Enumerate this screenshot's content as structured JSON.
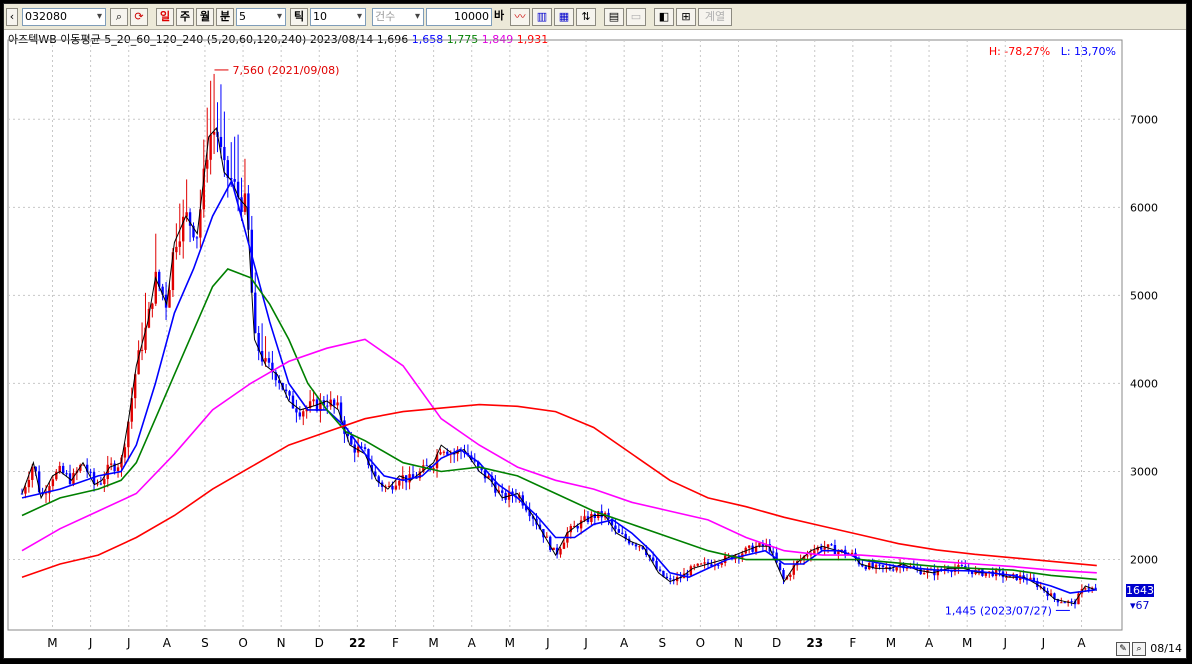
{
  "toolbar": {
    "code": "032080",
    "periods": [
      "일",
      "주",
      "월",
      "분"
    ],
    "minute_value": "5",
    "tick_label": "틱",
    "tick_value": "10",
    "count_label": "건수",
    "count_value": "10000",
    "count_unit": "바",
    "disabled_button": "계열"
  },
  "header": {
    "name": "아즈텍WB 이동평균 5_20_60_120_240",
    "params": "(5,20,60,120,240)",
    "date": "2023/08/14",
    "ma_values": [
      "1,696",
      "1,658",
      "1,775",
      "1,849",
      "1,931"
    ],
    "high_label": "H: -78,27%",
    "low_label": "L: 13,70%"
  },
  "footer_date": "08/14",
  "colors": {
    "ma5": "#000000",
    "ma20": "#0000ff",
    "ma60": "#008000",
    "ma120": "#ff00ff",
    "ma240": "#ff0000",
    "up": "#e00000",
    "down": "#0000ff",
    "grid": "#c8c8c8"
  },
  "chart_data": {
    "type": "line",
    "y_ticks": [
      2000,
      3000,
      4000,
      5000,
      6000,
      7000
    ],
    "ylim": [
      1200,
      7900
    ],
    "x_ticks": [
      "M",
      "J",
      "J",
      "A",
      "S",
      "O",
      "N",
      "D",
      "22",
      "F",
      "M",
      "A",
      "M",
      "J",
      "J",
      "A",
      "S",
      "O",
      "N",
      "D",
      "23",
      "F",
      "M",
      "A",
      "M",
      "J",
      "J",
      "A"
    ],
    "annotations": [
      {
        "label": "7,560 (2021/09/08)",
        "t": 5.05,
        "value": 7560
      },
      {
        "label": "1,445 (2023/07/27)",
        "t": 27.6,
        "value": 1445
      }
    ],
    "current_price": "1643",
    "change": "67",
    "price_series": [
      {
        "t": 0.0,
        "v": 2750
      },
      {
        "t": 0.3,
        "v": 3100
      },
      {
        "t": 0.5,
        "v": 2700
      },
      {
        "t": 0.8,
        "v": 2950
      },
      {
        "t": 1.0,
        "v": 3000
      },
      {
        "t": 1.3,
        "v": 2900
      },
      {
        "t": 1.6,
        "v": 3100
      },
      {
        "t": 1.9,
        "v": 2850
      },
      {
        "t": 2.1,
        "v": 2900
      },
      {
        "t": 2.3,
        "v": 3050
      },
      {
        "t": 2.6,
        "v": 3100
      },
      {
        "t": 2.8,
        "v": 3600
      },
      {
        "t": 3.0,
        "v": 4200
      },
      {
        "t": 3.3,
        "v": 4700
      },
      {
        "t": 3.5,
        "v": 5200
      },
      {
        "t": 3.8,
        "v": 4900
      },
      {
        "t": 4.0,
        "v": 5600
      },
      {
        "t": 4.3,
        "v": 5900
      },
      {
        "t": 4.6,
        "v": 5700
      },
      {
        "t": 4.9,
        "v": 6800
      },
      {
        "t": 5.1,
        "v": 6900
      },
      {
        "t": 5.3,
        "v": 6400
      },
      {
        "t": 5.5,
        "v": 6300
      },
      {
        "t": 5.7,
        "v": 6100
      },
      {
        "t": 5.9,
        "v": 6000
      },
      {
        "t": 6.1,
        "v": 4500
      },
      {
        "t": 6.4,
        "v": 4200
      },
      {
        "t": 6.7,
        "v": 4100
      },
      {
        "t": 7.0,
        "v": 3800
      },
      {
        "t": 7.3,
        "v": 3700
      },
      {
        "t": 7.7,
        "v": 3750
      },
      {
        "t": 8.0,
        "v": 3800
      },
      {
        "t": 8.3,
        "v": 3700
      },
      {
        "t": 8.6,
        "v": 3300
      },
      {
        "t": 9.0,
        "v": 3200
      },
      {
        "t": 9.3,
        "v": 2900
      },
      {
        "t": 9.6,
        "v": 2800
      },
      {
        "t": 9.9,
        "v": 2950
      },
      {
        "t": 10.2,
        "v": 2900
      },
      {
        "t": 10.5,
        "v": 3000
      },
      {
        "t": 10.8,
        "v": 3100
      },
      {
        "t": 11.0,
        "v": 3300
      },
      {
        "t": 11.3,
        "v": 3200
      },
      {
        "t": 11.6,
        "v": 3250
      },
      {
        "t": 12.0,
        "v": 3000
      },
      {
        "t": 12.3,
        "v": 2900
      },
      {
        "t": 12.6,
        "v": 2700
      },
      {
        "t": 13.0,
        "v": 2750
      },
      {
        "t": 13.4,
        "v": 2500
      },
      {
        "t": 13.8,
        "v": 2200
      },
      {
        "t": 14.0,
        "v": 2050
      },
      {
        "t": 14.3,
        "v": 2300
      },
      {
        "t": 14.6,
        "v": 2400
      },
      {
        "t": 15.0,
        "v": 2500
      },
      {
        "t": 15.3,
        "v": 2500
      },
      {
        "t": 15.6,
        "v": 2300
      },
      {
        "t": 16.0,
        "v": 2200
      },
      {
        "t": 16.3,
        "v": 2150
      },
      {
        "t": 16.7,
        "v": 1850
      },
      {
        "t": 17.0,
        "v": 1750
      },
      {
        "t": 17.3,
        "v": 1800
      },
      {
        "t": 17.6,
        "v": 1900
      },
      {
        "t": 18.0,
        "v": 1950
      },
      {
        "t": 18.4,
        "v": 2000
      },
      {
        "t": 18.7,
        "v": 2050
      },
      {
        "t": 19.0,
        "v": 2100
      },
      {
        "t": 19.3,
        "v": 2150
      },
      {
        "t": 19.6,
        "v": 2150
      },
      {
        "t": 20.0,
        "v": 1750
      },
      {
        "t": 20.3,
        "v": 1950
      },
      {
        "t": 20.7,
        "v": 2100
      },
      {
        "t": 21.0,
        "v": 2150
      },
      {
        "t": 21.4,
        "v": 2100
      },
      {
        "t": 21.8,
        "v": 2050
      },
      {
        "t": 22.0,
        "v": 1950
      },
      {
        "t": 22.4,
        "v": 1900
      },
      {
        "t": 22.8,
        "v": 1900
      },
      {
        "t": 23.1,
        "v": 1950
      },
      {
        "t": 23.5,
        "v": 1880
      },
      {
        "t": 23.9,
        "v": 1850
      },
      {
        "t": 24.3,
        "v": 1900
      },
      {
        "t": 24.7,
        "v": 1900
      },
      {
        "t": 25.1,
        "v": 1850
      },
      {
        "t": 25.5,
        "v": 1850
      },
      {
        "t": 25.9,
        "v": 1800
      },
      {
        "t": 26.3,
        "v": 1800
      },
      {
        "t": 26.7,
        "v": 1700
      },
      {
        "t": 27.1,
        "v": 1550
      },
      {
        "t": 27.6,
        "v": 1500
      },
      {
        "t": 27.9,
        "v": 1700
      },
      {
        "t": 28.2,
        "v": 1650
      }
    ],
    "series": [
      {
        "key": "ma20",
        "points": [
          {
            "t": 0.0,
            "v": 2700
          },
          {
            "t": 1.0,
            "v": 2800
          },
          {
            "t": 2.0,
            "v": 2950
          },
          {
            "t": 2.6,
            "v": 3000
          },
          {
            "t": 3.0,
            "v": 3300
          },
          {
            "t": 3.5,
            "v": 4000
          },
          {
            "t": 4.0,
            "v": 4800
          },
          {
            "t": 4.5,
            "v": 5300
          },
          {
            "t": 5.0,
            "v": 5900
          },
          {
            "t": 5.5,
            "v": 6300
          },
          {
            "t": 6.0,
            "v": 5500
          },
          {
            "t": 6.5,
            "v": 4700
          },
          {
            "t": 7.0,
            "v": 4000
          },
          {
            "t": 7.5,
            "v": 3700
          },
          {
            "t": 8.0,
            "v": 3700
          },
          {
            "t": 8.5,
            "v": 3500
          },
          {
            "t": 9.0,
            "v": 3200
          },
          {
            "t": 9.5,
            "v": 2950
          },
          {
            "t": 10.0,
            "v": 2900
          },
          {
            "t": 10.5,
            "v": 2950
          },
          {
            "t": 11.0,
            "v": 3150
          },
          {
            "t": 11.5,
            "v": 3250
          },
          {
            "t": 12.0,
            "v": 3100
          },
          {
            "t": 12.5,
            "v": 2850
          },
          {
            "t": 13.0,
            "v": 2700
          },
          {
            "t": 13.5,
            "v": 2500
          },
          {
            "t": 14.0,
            "v": 2250
          },
          {
            "t": 14.5,
            "v": 2250
          },
          {
            "t": 15.0,
            "v": 2400
          },
          {
            "t": 15.5,
            "v": 2450
          },
          {
            "t": 16.0,
            "v": 2300
          },
          {
            "t": 16.5,
            "v": 2100
          },
          {
            "t": 17.0,
            "v": 1850
          },
          {
            "t": 17.5,
            "v": 1800
          },
          {
            "t": 18.0,
            "v": 1900
          },
          {
            "t": 18.5,
            "v": 2000
          },
          {
            "t": 19.0,
            "v": 2050
          },
          {
            "t": 19.5,
            "v": 2100
          },
          {
            "t": 20.0,
            "v": 1950
          },
          {
            "t": 20.5,
            "v": 1950
          },
          {
            "t": 21.0,
            "v": 2100
          },
          {
            "t": 21.5,
            "v": 2100
          },
          {
            "t": 22.0,
            "v": 2000
          },
          {
            "t": 23.0,
            "v": 1920
          },
          {
            "t": 24.0,
            "v": 1880
          },
          {
            "t": 25.0,
            "v": 1870
          },
          {
            "t": 26.0,
            "v": 1820
          },
          {
            "t": 27.0,
            "v": 1700
          },
          {
            "t": 27.5,
            "v": 1620
          },
          {
            "t": 28.2,
            "v": 1658
          }
        ]
      },
      {
        "key": "ma60",
        "points": [
          {
            "t": 0.0,
            "v": 2500
          },
          {
            "t": 1.0,
            "v": 2700
          },
          {
            "t": 2.0,
            "v": 2800
          },
          {
            "t": 2.6,
            "v": 2900
          },
          {
            "t": 3.0,
            "v": 3100
          },
          {
            "t": 3.5,
            "v": 3600
          },
          {
            "t": 4.0,
            "v": 4100
          },
          {
            "t": 4.5,
            "v": 4600
          },
          {
            "t": 5.0,
            "v": 5100
          },
          {
            "t": 5.4,
            "v": 5300
          },
          {
            "t": 6.0,
            "v": 5200
          },
          {
            "t": 6.5,
            "v": 4900
          },
          {
            "t": 7.0,
            "v": 4500
          },
          {
            "t": 7.5,
            "v": 4000
          },
          {
            "t": 8.0,
            "v": 3700
          },
          {
            "t": 8.5,
            "v": 3450
          },
          {
            "t": 9.0,
            "v": 3350
          },
          {
            "t": 10.0,
            "v": 3100
          },
          {
            "t": 11.0,
            "v": 3000
          },
          {
            "t": 12.0,
            "v": 3050
          },
          {
            "t": 13.0,
            "v": 2950
          },
          {
            "t": 14.0,
            "v": 2750
          },
          {
            "t": 15.0,
            "v": 2550
          },
          {
            "t": 16.0,
            "v": 2400
          },
          {
            "t": 17.0,
            "v": 2250
          },
          {
            "t": 18.0,
            "v": 2100
          },
          {
            "t": 19.0,
            "v": 2000
          },
          {
            "t": 20.0,
            "v": 2000
          },
          {
            "t": 21.0,
            "v": 2000
          },
          {
            "t": 22.0,
            "v": 2000
          },
          {
            "t": 23.0,
            "v": 1960
          },
          {
            "t": 24.0,
            "v": 1920
          },
          {
            "t": 25.0,
            "v": 1900
          },
          {
            "t": 26.0,
            "v": 1880
          },
          {
            "t": 27.0,
            "v": 1820
          },
          {
            "t": 28.2,
            "v": 1775
          }
        ]
      },
      {
        "key": "ma120",
        "points": [
          {
            "t": 0.0,
            "v": 2100
          },
          {
            "t": 1.0,
            "v": 2350
          },
          {
            "t": 2.0,
            "v": 2550
          },
          {
            "t": 3.0,
            "v": 2750
          },
          {
            "t": 4.0,
            "v": 3200
          },
          {
            "t": 5.0,
            "v": 3700
          },
          {
            "t": 6.0,
            "v": 4000
          },
          {
            "t": 7.0,
            "v": 4250
          },
          {
            "t": 8.0,
            "v": 4400
          },
          {
            "t": 9.0,
            "v": 4500
          },
          {
            "t": 10.0,
            "v": 4200
          },
          {
            "t": 11.0,
            "v": 3600
          },
          {
            "t": 12.0,
            "v": 3300
          },
          {
            "t": 13.0,
            "v": 3050
          },
          {
            "t": 14.0,
            "v": 2900
          },
          {
            "t": 15.0,
            "v": 2800
          },
          {
            "t": 16.0,
            "v": 2650
          },
          {
            "t": 17.0,
            "v": 2550
          },
          {
            "t": 18.0,
            "v": 2450
          },
          {
            "t": 19.0,
            "v": 2250
          },
          {
            "t": 20.0,
            "v": 2100
          },
          {
            "t": 21.0,
            "v": 2050
          },
          {
            "t": 22.0,
            "v": 2050
          },
          {
            "t": 23.0,
            "v": 2020
          },
          {
            "t": 24.0,
            "v": 1980
          },
          {
            "t": 25.0,
            "v": 1950
          },
          {
            "t": 26.0,
            "v": 1920
          },
          {
            "t": 27.0,
            "v": 1880
          },
          {
            "t": 28.2,
            "v": 1849
          }
        ]
      },
      {
        "key": "ma240",
        "points": [
          {
            "t": 0.0,
            "v": 1800
          },
          {
            "t": 1.0,
            "v": 1950
          },
          {
            "t": 2.0,
            "v": 2050
          },
          {
            "t": 3.0,
            "v": 2250
          },
          {
            "t": 4.0,
            "v": 2500
          },
          {
            "t": 5.0,
            "v": 2800
          },
          {
            "t": 6.0,
            "v": 3050
          },
          {
            "t": 7.0,
            "v": 3300
          },
          {
            "t": 8.0,
            "v": 3450
          },
          {
            "t": 9.0,
            "v": 3600
          },
          {
            "t": 10.0,
            "v": 3680
          },
          {
            "t": 11.0,
            "v": 3720
          },
          {
            "t": 12.0,
            "v": 3760
          },
          {
            "t": 13.0,
            "v": 3740
          },
          {
            "t": 14.0,
            "v": 3680
          },
          {
            "t": 15.0,
            "v": 3500
          },
          {
            "t": 16.0,
            "v": 3200
          },
          {
            "t": 17.0,
            "v": 2900
          },
          {
            "t": 18.0,
            "v": 2700
          },
          {
            "t": 19.0,
            "v": 2600
          },
          {
            "t": 20.0,
            "v": 2480
          },
          {
            "t": 21.0,
            "v": 2380
          },
          {
            "t": 22.0,
            "v": 2280
          },
          {
            "t": 23.0,
            "v": 2180
          },
          {
            "t": 24.0,
            "v": 2110
          },
          {
            "t": 25.0,
            "v": 2060
          },
          {
            "t": 26.0,
            "v": 2020
          },
          {
            "t": 27.0,
            "v": 1980
          },
          {
            "t": 28.2,
            "v": 1931
          }
        ]
      }
    ]
  }
}
